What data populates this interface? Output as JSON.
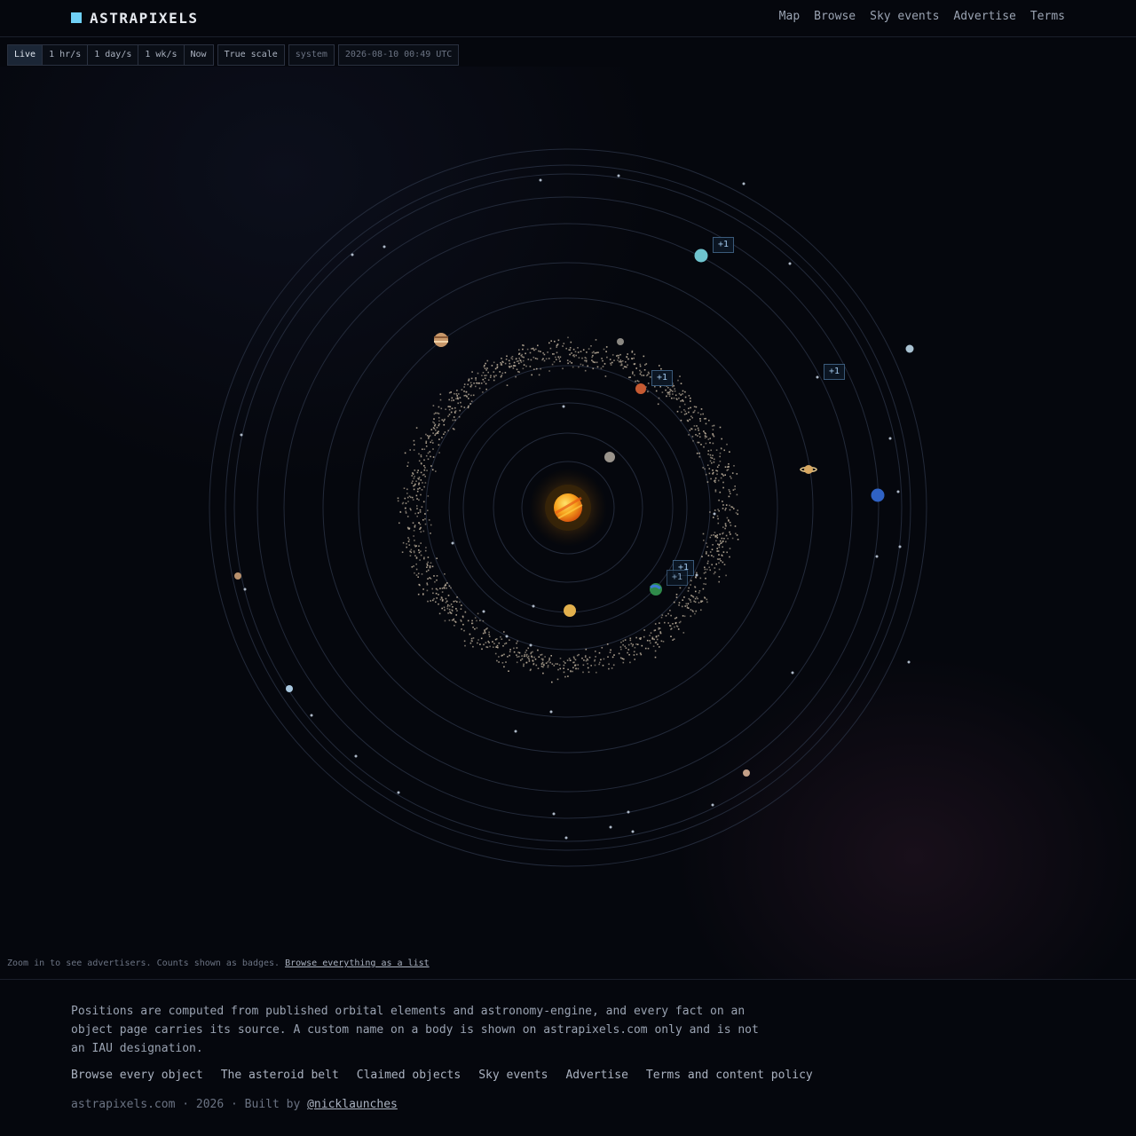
{
  "brand": {
    "name": "ASTRAPIXELS",
    "accent": "#6fd0f5"
  },
  "nav": {
    "items": [
      "Map",
      "Browse",
      "Sky events",
      "Advertise",
      "Terms"
    ]
  },
  "toolbar": {
    "speeds": [
      {
        "label": "Live",
        "active": true
      },
      {
        "label": "1 hr/s",
        "active": false
      },
      {
        "label": "1 day/s",
        "active": false
      },
      {
        "label": "1 wk/s",
        "active": false
      },
      {
        "label": "Now",
        "active": false
      }
    ],
    "scale_label": "True scale",
    "view_label": "system",
    "timestamp": "2026-08-10 00:49 UTC"
  },
  "map": {
    "badges": [
      "+1",
      "+1",
      "+1",
      "+1",
      "+1"
    ],
    "hint_text": "Zoom in to see advertisers. Counts shown as badges.",
    "hint_link": "Browse everything as a list",
    "planets": [
      {
        "name": "mercury",
        "color": "#9a948c"
      },
      {
        "name": "venus",
        "color": "#e2b04d"
      },
      {
        "name": "earth",
        "color": "#2f8a4a"
      },
      {
        "name": "mars",
        "color": "#c65a32"
      },
      {
        "name": "jupiter",
        "color": "#c8986a"
      },
      {
        "name": "saturn",
        "color": "#d8a862"
      },
      {
        "name": "uranus",
        "color": "#6fc4cf"
      },
      {
        "name": "neptune",
        "color": "#2f62c4"
      }
    ]
  },
  "footer": {
    "text": "Positions are computed from published orbital elements and astronomy-engine, and every fact on an object page carries its source. A custom name on a body is shown on astrapixels.com only and is not an IAU designation.",
    "links": [
      "Browse every object",
      "The asteroid belt",
      "Claimed objects",
      "Sky events",
      "Advertise",
      "Terms and content policy"
    ],
    "credit_prefix": "astrapixels.com · 2026 · Built by",
    "credit_link": "@nicklaunches"
  }
}
